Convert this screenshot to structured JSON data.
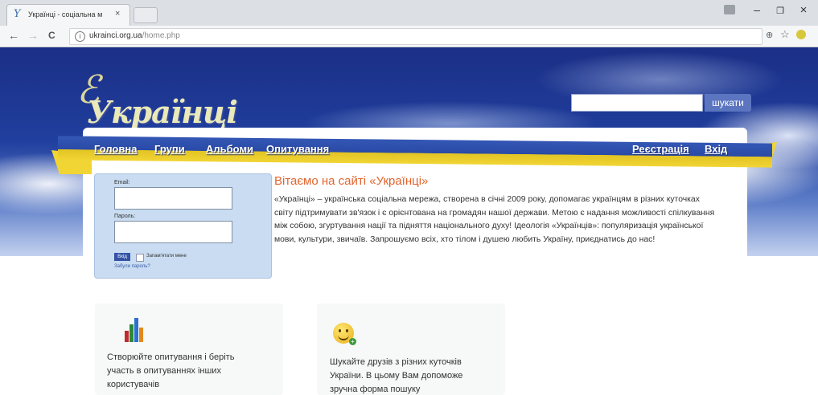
{
  "browser": {
    "tab_title": "Українці - соціальна м",
    "tab_close": "×",
    "url_host": "ukrainci.org.ua",
    "url_path": "/home.php",
    "back": "←",
    "forward": "→",
    "reload": "C",
    "minimize": "–",
    "maximize": "❐",
    "close": "×",
    "info": "i",
    "zoom": "⊕",
    "star": "☆"
  },
  "site": {
    "logo_text": "Українці",
    "logo_mark": "ℰ",
    "search_button": "шукати",
    "search_placeholder": "",
    "nav": [
      "Головна",
      "Групи",
      "Альбоми",
      "Опитування"
    ],
    "nav_right": [
      "Реєстрація",
      "Вхід"
    ]
  },
  "login": {
    "email_label": "Email:",
    "password_label": "Пароль:",
    "submit": "Вхід",
    "remember": "Запам'ятати мене",
    "forgot": "Забули пароль?"
  },
  "welcome": {
    "title": "Вітаємо на сайті «Українці»",
    "text": "«Українці» – українська соціальна мережа, створена в січні 2009 року, допомагає українцям в різних куточках світу підтримувати зв'язок і є орієнтована на громадян нашої держави. Метою є надання можливості спілкування між собою, згуртування нації та підняття національного духу! Ідеологія «Українців»: популяризація української мови, культури, звичаїв. Запрошуємо всіх, хто тілом і душею любить Україну, приєднатись до нас!"
  },
  "features": [
    {
      "icon": "bar-chart-icon",
      "text": "Створюйте опитування і беріть участь в опитуваннях інших користувачів"
    },
    {
      "icon": "smiley-icon",
      "text": "Шукайте друзів з різних куточків України. В цьому Вам допоможе зручна форма пошуку"
    }
  ],
  "colors": {
    "nav_blue": "#2a4aa6",
    "nav_yellow": "#f1d534",
    "welcome_title": "#e2642d",
    "login_bg": "#c9dcf1"
  }
}
